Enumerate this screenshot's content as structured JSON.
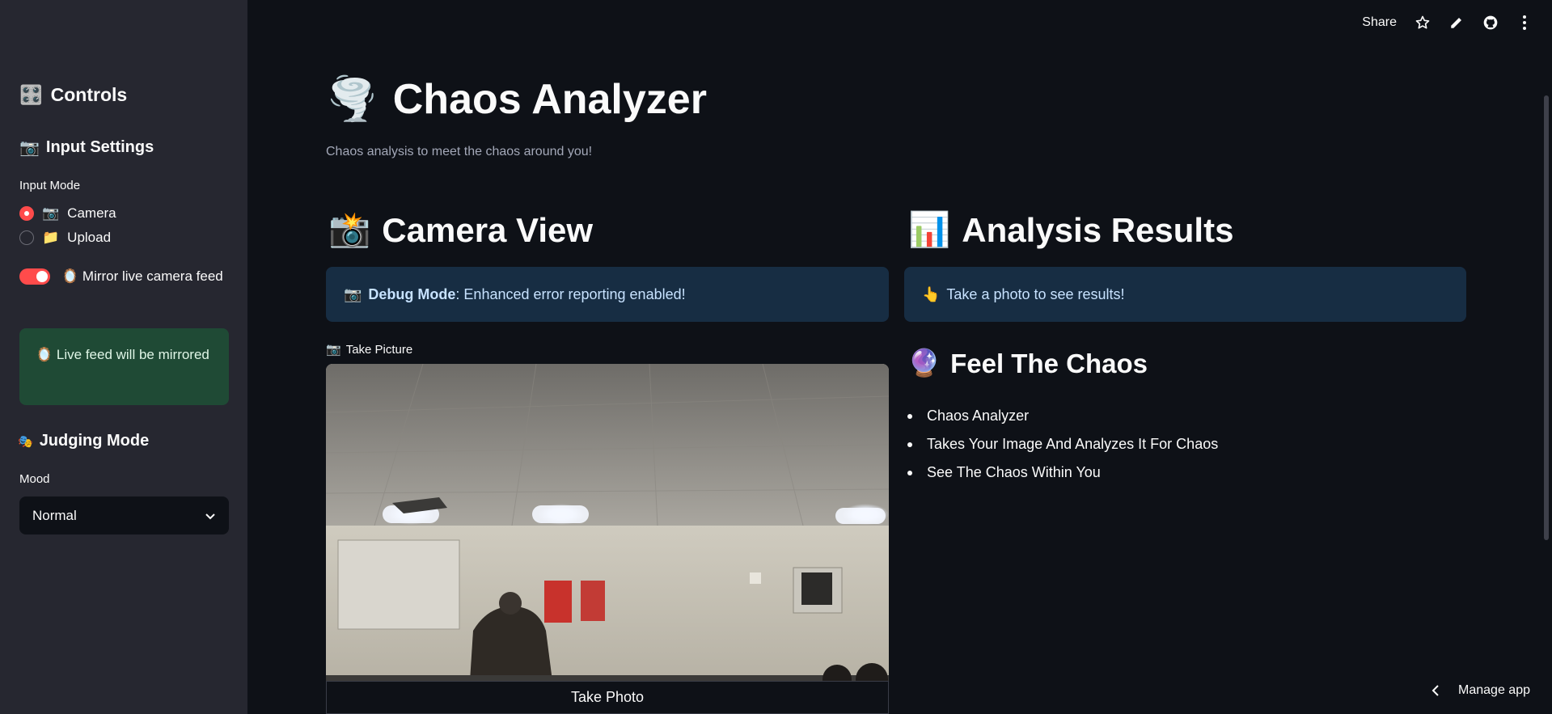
{
  "sidebar": {
    "controls_icon": "🎛️",
    "controls_title": "Controls",
    "input_settings_icon": "📷",
    "input_settings_title": "Input Settings",
    "input_mode_label": "Input Mode",
    "radio_options": [
      {
        "icon": "📷",
        "label": "Camera",
        "selected": true
      },
      {
        "icon": "📁",
        "label": "Upload",
        "selected": false
      }
    ],
    "mirror_icon": "🪞",
    "mirror_label": "Mirror live camera feed",
    "mirror_on": true,
    "mirror_alert_icon": "🪞",
    "mirror_alert_text": "Live feed will be mirrored",
    "judging_icon": "🎭",
    "judging_title": "Judging Mode",
    "mood_label": "Mood",
    "mood_value": "Normal"
  },
  "toolbar": {
    "share_label": "Share",
    "icons": [
      "star-icon",
      "edit-icon",
      "github-icon",
      "more-vert-icon"
    ]
  },
  "main": {
    "title_icon": "🌪️",
    "title": "Chaos Analyzer",
    "subtitle": "Chaos analysis to meet the chaos around you!",
    "camera_view_icon": "📸",
    "camera_view_title": "Camera View",
    "debug_icon": "📷",
    "debug_bold": "Debug Mode",
    "debug_text": ": Enhanced error reporting enabled!",
    "take_picture_icon": "📷",
    "take_picture_label": "Take Picture",
    "take_photo_button": "Take Photo",
    "analysis_icon": "📊",
    "analysis_title": "Analysis Results",
    "results_icon": "👆",
    "results_text": "Take a photo to see results!",
    "feel_icon": "🔮",
    "feel_title": "Feel The Chaos",
    "bullets": [
      "Chaos Analyzer",
      "Takes Your Image And Analyzes It For Chaos",
      "See The Chaos Within You"
    ],
    "manage_app": "Manage app"
  },
  "colors": {
    "background": "#0e1117",
    "sidebar": "#262730",
    "accent": "#ff4b4b",
    "info_bg": "#172d43",
    "success_bg": "#1f4a35"
  }
}
